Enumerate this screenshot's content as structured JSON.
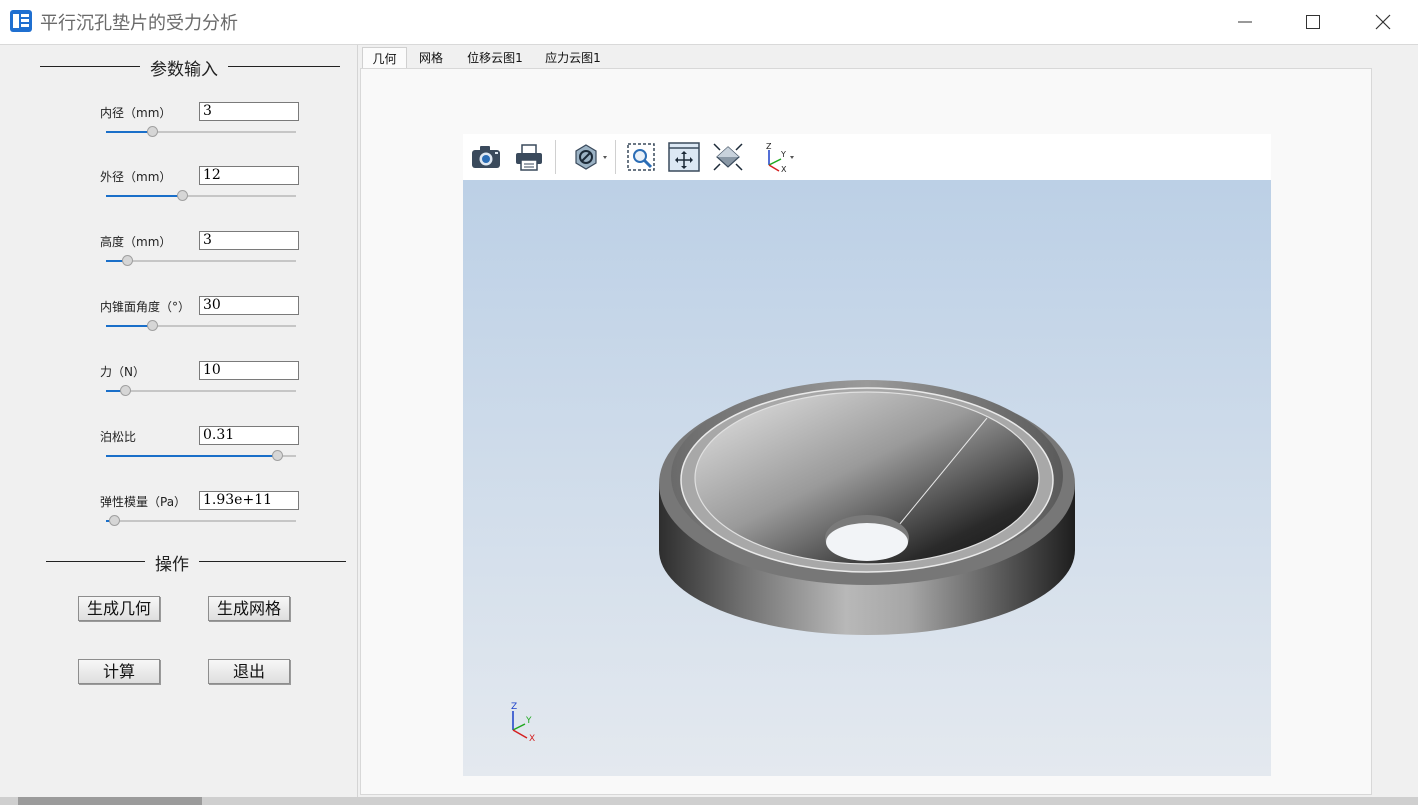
{
  "window": {
    "title": "平行沉孔垫片的受力分析",
    "controls": [
      "minimize",
      "maximize",
      "close"
    ]
  },
  "params_group": {
    "title": "参数输入"
  },
  "params": [
    {
      "label": "内径（mm）",
      "value": "3",
      "slider_fraction": 0.24
    },
    {
      "label": "外径（mm）",
      "value": "12",
      "slider_fraction": 0.4
    },
    {
      "label": "高度（mm）",
      "value": "3",
      "slider_fraction": 0.11
    },
    {
      "label": "内锥面角度（°）",
      "value": "30",
      "slider_fraction": 0.24
    },
    {
      "label": "力（N）",
      "value": "10",
      "slider_fraction": 0.1
    },
    {
      "label": "泊松比",
      "value": "0.31",
      "slider_fraction": 0.9
    },
    {
      "label": "弹性模量（Pa）",
      "value": "1.93e+11",
      "slider_fraction": 0.04
    }
  ],
  "ops_group": {
    "title": "操作"
  },
  "buttons": {
    "gen_geometry": "生成几何",
    "gen_mesh": "生成网格",
    "compute": "计算",
    "exit": "退出"
  },
  "tabs": [
    {
      "label": "几何",
      "active": true
    },
    {
      "label": "网格",
      "active": false
    },
    {
      "label": "位移云图1",
      "active": false
    },
    {
      "label": "应力云图1",
      "active": false
    }
  ],
  "toolbar_icons": [
    "camera-icon",
    "print-icon",
    "display-mode-icon",
    "zoom-box-icon",
    "pan-icon",
    "fit-view-icon",
    "axis-view-icon"
  ],
  "triad": {
    "x": "X",
    "y": "Y",
    "z": "Z"
  },
  "colors": {
    "accent": "#1a6fc9",
    "viewport_top": "#bcd0e6",
    "viewport_bottom": "#e4e9ef",
    "axis_x": "#d42020",
    "axis_y": "#1fa81f",
    "axis_z": "#1a3fc9"
  }
}
